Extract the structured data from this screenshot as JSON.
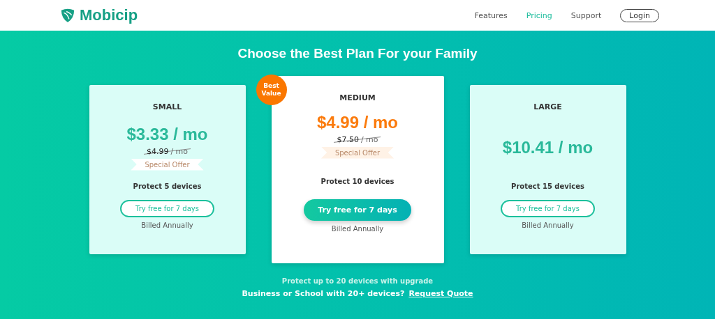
{
  "header": {
    "brand": "Mobicip",
    "nav": [
      {
        "label": "Features",
        "selected": false
      },
      {
        "label": "Pricing",
        "selected": true
      },
      {
        "label": "Support",
        "selected": false
      }
    ],
    "login": "Login"
  },
  "title": "Choose the Best Plan For your Family",
  "plans": [
    {
      "name": "SMALL",
      "featured": false,
      "price": "$3.33 / mo",
      "old_price": "$4.99",
      "old_unit": "/ mo",
      "offer": "Special Offer",
      "devices": "Protect 5 devices",
      "button": "Try free for 7 days",
      "billing": "Billed Annually"
    },
    {
      "name": "MEDIUM",
      "featured": true,
      "badge": "Best Value",
      "price": "$4.99 / mo",
      "old_price": "$7.50",
      "old_unit": "/ mo",
      "offer": "Special Offer",
      "devices": "Protect 10 devices",
      "button": "Try free for 7 days",
      "billing": "Billed Annually"
    },
    {
      "name": "LARGE",
      "featured": false,
      "price": "$10.41 / mo",
      "devices": "Protect 15 devices",
      "button": "Try free for 7 days",
      "billing": "Billed Annually"
    }
  ],
  "upgrade_note": "Protect up to 20 devices with upgrade",
  "business": {
    "text": "Business or School with 20+ devices?",
    "link": "Request Quote"
  }
}
